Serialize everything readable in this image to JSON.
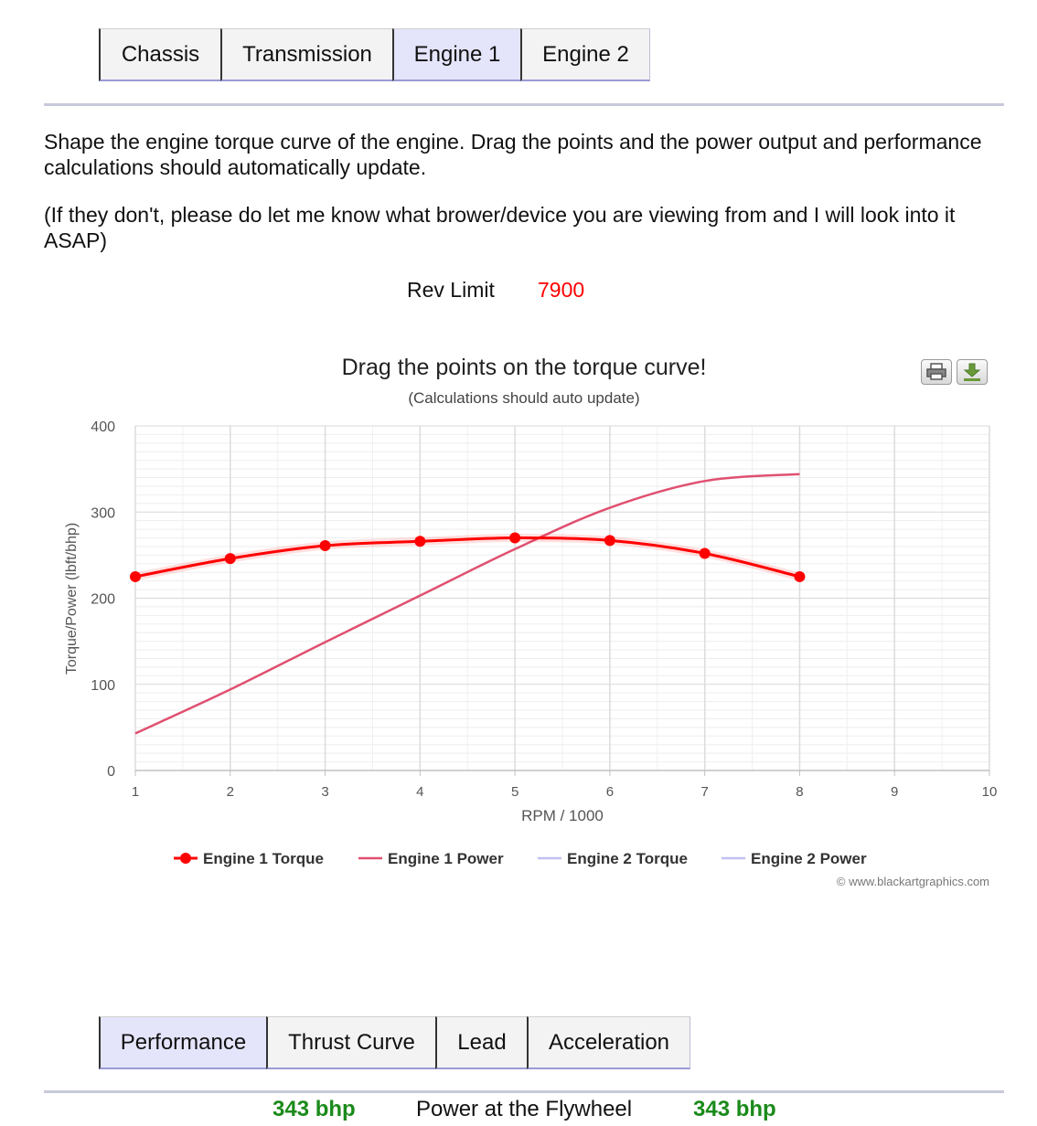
{
  "top_tabs": [
    {
      "label": "Chassis",
      "active": false
    },
    {
      "label": "Transmission",
      "active": false
    },
    {
      "label": "Engine 1",
      "active": true
    },
    {
      "label": "Engine 2",
      "active": false
    }
  ],
  "intro": {
    "line1": "Shape the engine torque curve of the engine. Drag the points and the power output and performance calculations should automatically update.",
    "line2": "(If they don't, please do let me know what brower/device you are viewing from and I will look into it ASAP)"
  },
  "rev_limit": {
    "label": "Rev Limit",
    "value": "7900"
  },
  "chart": {
    "title": "Drag the points on the torque curve!",
    "subtitle": "(Calculations should auto update)",
    "credit": "© www.blackartgraphics.com",
    "print_icon": "print-icon",
    "download_icon": "download-icon"
  },
  "chart_data": {
    "type": "line",
    "xlabel": "RPM / 1000",
    "ylabel": "Torque/Power (lbft/bhp)",
    "xlim": [
      1,
      10
    ],
    "ylim": [
      0,
      400
    ],
    "x_ticks": [
      "1",
      "2",
      "3",
      "4",
      "5",
      "6",
      "7",
      "8",
      "9",
      "10"
    ],
    "y_ticks": [
      "0",
      "100",
      "200",
      "300",
      "400"
    ],
    "grid": true,
    "legend_position": "bottom",
    "series": [
      {
        "name": "Engine 1 Torque",
        "color": "#ff0000",
        "markers": true,
        "x": [
          1,
          2,
          3,
          4,
          5,
          6,
          7,
          8
        ],
        "y": [
          225,
          246,
          261,
          266,
          270,
          267,
          252,
          225
        ]
      },
      {
        "name": "Engine 1 Power",
        "color": "#e05070",
        "markers": false,
        "x": [
          1,
          2,
          3,
          4,
          5,
          6,
          7,
          8
        ],
        "y": [
          43,
          94,
          149,
          203,
          257,
          305,
          336,
          344
        ]
      },
      {
        "name": "Engine 2 Torque",
        "color": "#c0c0f0",
        "markers": false,
        "x": [],
        "y": []
      },
      {
        "name": "Engine 2 Power",
        "color": "#c0c0f0",
        "markers": false,
        "x": [],
        "y": []
      }
    ]
  },
  "bottom_tabs": [
    {
      "label": "Performance",
      "active": true
    },
    {
      "label": "Thrust Curve",
      "active": false
    },
    {
      "label": "Lead",
      "active": false
    },
    {
      "label": "Acceleration",
      "active": false
    }
  ],
  "results": {
    "engine1_power": "343 bhp",
    "label": "Power at the Flywheel",
    "engine2_power": "343 bhp"
  }
}
